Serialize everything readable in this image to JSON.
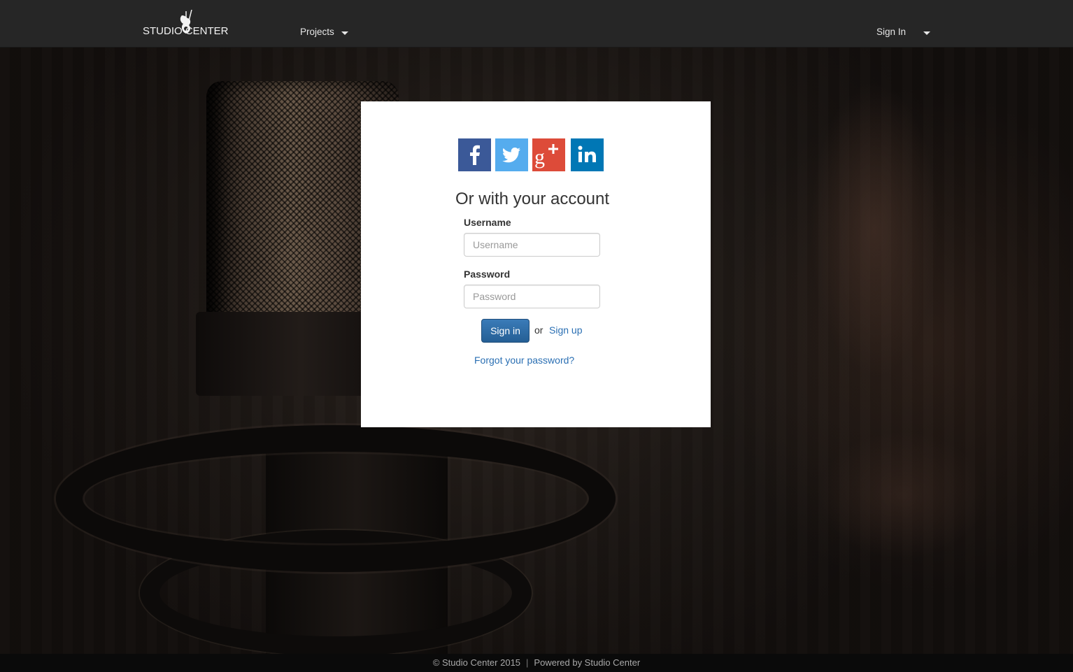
{
  "navbar": {
    "brand": "STUDIO CENTER",
    "projects_label": "Projects",
    "signin_label": "Sign In"
  },
  "social": {
    "facebook": "facebook-icon",
    "twitter": "twitter-icon",
    "google_plus": "google-plus-icon",
    "linkedin": "linkedin-icon"
  },
  "login": {
    "title": "Or with your account",
    "username_label": "Username",
    "username_placeholder": "Username",
    "username_value": "",
    "password_label": "Password",
    "password_placeholder": "Password",
    "password_value": "",
    "signin_button": "Sign in",
    "or_text": "or",
    "signup_link": "Sign up",
    "forgot_link": "Forgot your password?"
  },
  "footer": {
    "copyright": "© Studio Center 2015",
    "separator": "|",
    "powered": "Powered by Studio Center"
  },
  "colors": {
    "navbar_bg": "#262626",
    "primary_button": "#2f6ea8",
    "link": "#2a6fb3",
    "facebook": "#3b5998",
    "twitter": "#55acee",
    "google_plus": "#dd4b39",
    "linkedin": "#0077b5"
  }
}
